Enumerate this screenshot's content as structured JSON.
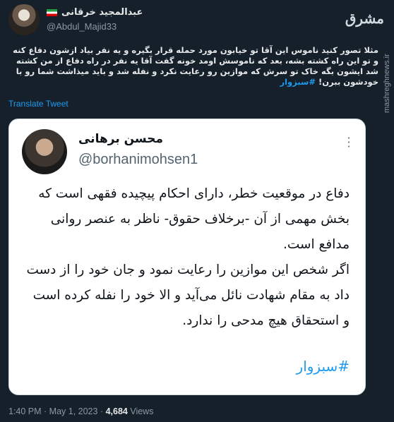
{
  "author": {
    "name": "عبدالمجید خرقانی",
    "handle": "@Abdul_Majid33"
  },
  "brand": {
    "logo_text": "مشرق",
    "side_watermark": "mashreghnews.ir"
  },
  "tweet": {
    "text": "مثلا تصور کنید ناموس این آقا تو خیابون مورد حمله قرار بگیره و یه نفر بیاد ازشون دفاع کنه و تو این راه کشته بشه، بعد که ناموسش اومد خونه گفت آقا یه نفر در راه دفاع از من کشته شد ایشون بگه خاک تو سرش که موازین رو رعایت نکرد و نفله شد و باید میذاشت شما رو با خودشون ببرن!",
    "hashtag": "#سبزوار",
    "translate_label": "Translate Tweet"
  },
  "quote": {
    "name": "محسن برهانی",
    "handle": "@borhanimohsen1",
    "more_icon": "more-vertical-icon",
    "body": "دفاع در موقعیت خطر، دارای احکام پیچیده فقهی است که بخش مهمی از آن -برخلاف حقوق- ناظر به عنصر روانی مدافع است.\nاگر شخص این موازین را رعایت نمود و جان خود را از دست داد به مقام شهادت نائل می‌آید و الا خود را نفله کرده است و استحقاق هیچ مدحی را ندارد.",
    "hashtag": "#سبزوار"
  },
  "meta": {
    "time": "1:40 PM",
    "sep1": " · ",
    "date": "May 1, 2023",
    "sep2": " · ",
    "views_count": "4,684",
    "views_label": " Views"
  },
  "colors": {
    "background": "#15202b",
    "accent": "#1d9bf0",
    "card": "#ffffff"
  }
}
